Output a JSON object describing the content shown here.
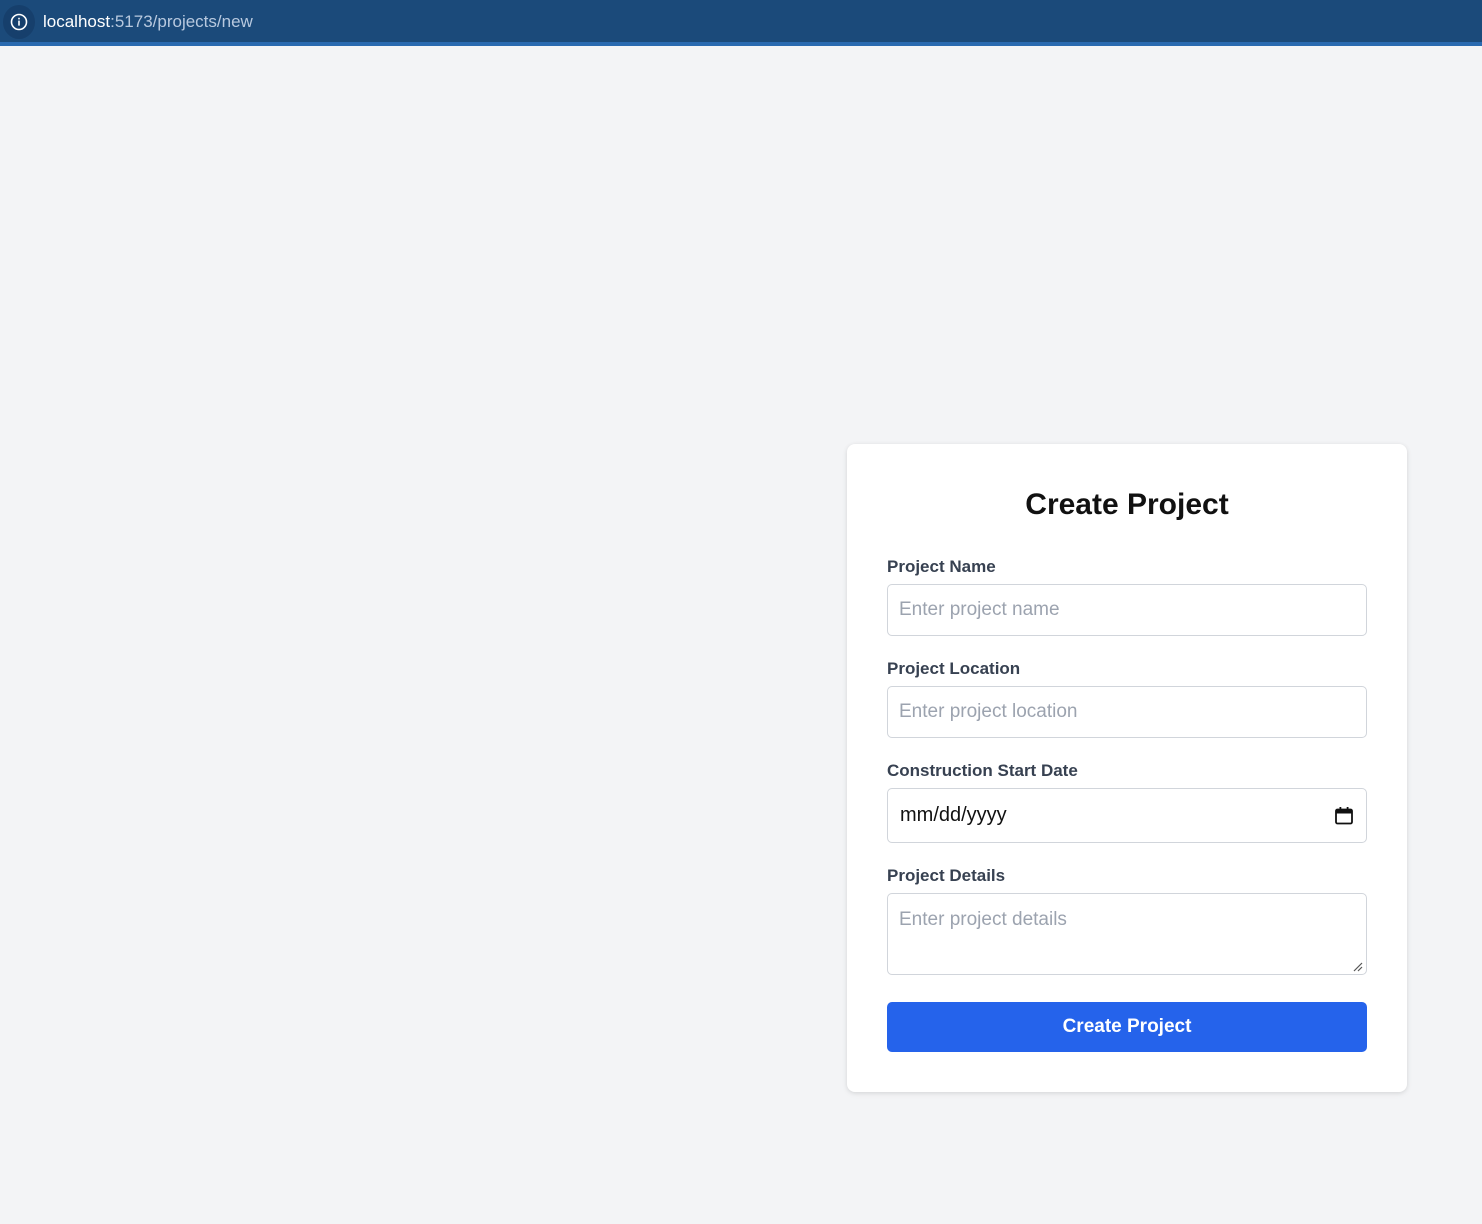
{
  "browser": {
    "url_host": "localhost",
    "url_path": ":5173/projects/new"
  },
  "form": {
    "title": "Create Project",
    "fields": {
      "name": {
        "label": "Project Name",
        "placeholder": "Enter project name",
        "value": ""
      },
      "location": {
        "label": "Project Location",
        "placeholder": "Enter project location",
        "value": ""
      },
      "start_date": {
        "label": "Construction Start Date",
        "display": "mm/dd/yyyy"
      },
      "details": {
        "label": "Project Details",
        "placeholder": "Enter project details",
        "value": ""
      }
    },
    "submit_label": "Create Project"
  },
  "colors": {
    "primary": "#2563eb",
    "background": "#f3f4f6",
    "browser_bar": "#1b4a7a"
  },
  "icons": [
    "info-icon",
    "calendar-icon",
    "resize-handle-icon"
  ]
}
